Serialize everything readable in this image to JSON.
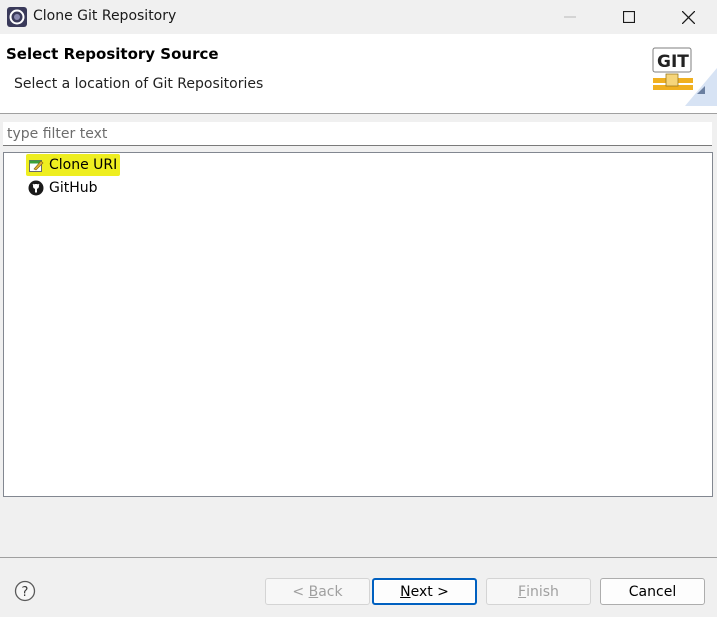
{
  "window": {
    "title": "Clone Git Repository"
  },
  "header": {
    "title": "Select Repository Source",
    "description": "Select a location of Git Repositories",
    "logo_text": "GIT"
  },
  "filter": {
    "placeholder": "type filter text",
    "value": ""
  },
  "tree": {
    "items": [
      {
        "label": "Clone URI",
        "icon": "clone-uri-icon",
        "selected": true
      },
      {
        "label": "GitHub",
        "icon": "github-icon",
        "selected": false
      }
    ]
  },
  "buttons": {
    "back": {
      "prefix": "< ",
      "mnemonic": "B",
      "rest": "ack",
      "enabled": false
    },
    "next": {
      "mnemonic": "N",
      "rest": "ext >",
      "enabled": true
    },
    "finish": {
      "mnemonic": "F",
      "rest": "inish",
      "enabled": false
    },
    "cancel": {
      "label": "Cancel",
      "enabled": true
    }
  },
  "colors": {
    "selection": "#eeee20",
    "default_button_border": "#0060c0"
  }
}
